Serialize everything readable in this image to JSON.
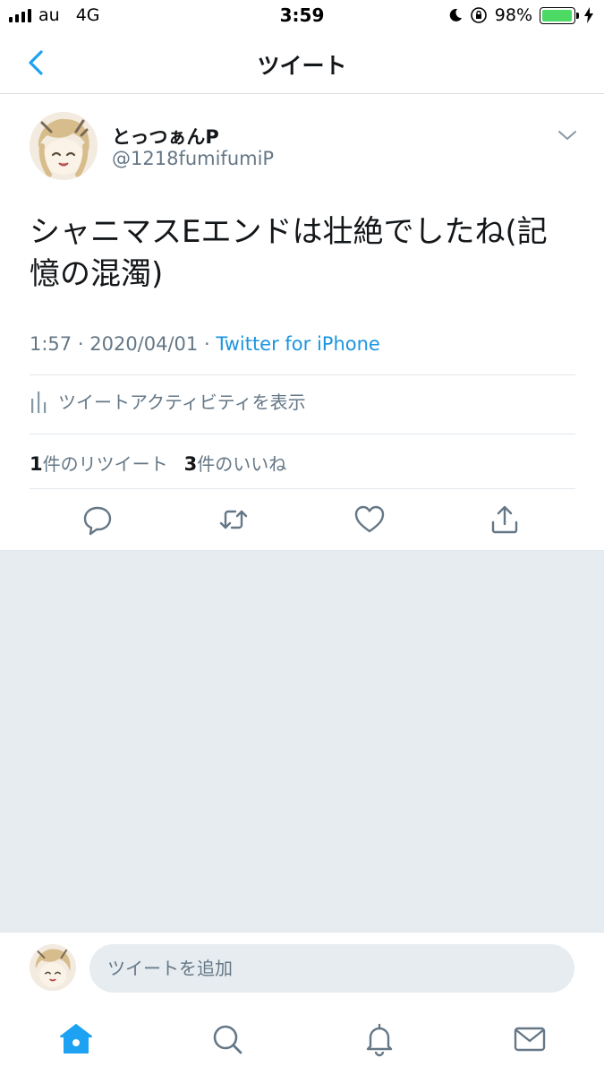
{
  "status_bar": {
    "carrier": "au",
    "network": "4G",
    "time": "3:59",
    "battery_percent": "98%",
    "battery_level": 0.98,
    "icons": [
      "signal-icon",
      "moon-icon",
      "orientation-lock-icon",
      "battery-icon",
      "charging-icon"
    ]
  },
  "nav": {
    "title": "ツイート",
    "back_icon": "chevron-left-icon"
  },
  "tweet": {
    "display_name": "とっつぁんP",
    "handle": "@1218fumifumiP",
    "text": "シャニマスEエンドは壮絶でしたね(記憶の混濁)",
    "time": "1:57",
    "date": "2020/04/01",
    "separator": "·",
    "source": "Twitter for iPhone",
    "activity_label": "ツイートアクティビティを表示",
    "retweet_count": "1",
    "retweet_label": "件のリツイート",
    "like_count": "3",
    "like_label": "件のいいね",
    "actions": [
      "reply-icon",
      "retweet-icon",
      "like-icon",
      "share-icon"
    ]
  },
  "composer": {
    "placeholder": "ツイートを追加"
  },
  "tabbar": {
    "items": [
      "home-icon",
      "search-icon",
      "notifications-icon",
      "messages-icon"
    ],
    "active": "home-icon"
  },
  "colors": {
    "accent": "#1da1f2",
    "link": "#1b95e0",
    "secondary_text": "#657786",
    "icon": "#657786",
    "background_gray": "#e6ecf0",
    "battery_fill": "#4cd964"
  }
}
